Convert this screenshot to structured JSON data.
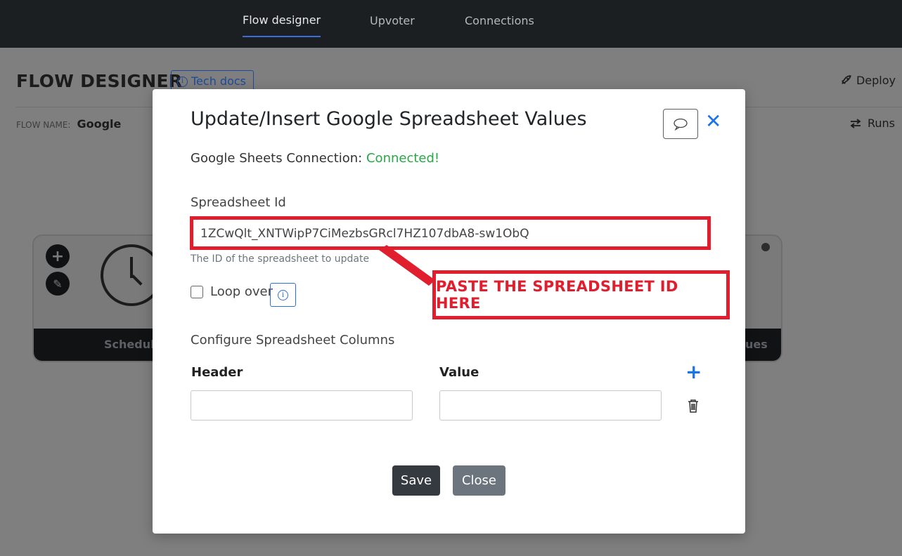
{
  "nav": {
    "tabs": [
      {
        "label": "Flow designer"
      },
      {
        "label": "Upvoter"
      },
      {
        "label": "Connections"
      }
    ]
  },
  "page": {
    "title": "FLOW DESIGNER",
    "tech_docs_label": "Tech docs",
    "deploy_label": "Deploy",
    "flow_name_label": "FLOW NAME:",
    "flow_name_value": "Google",
    "runs_label": "Runs",
    "left_card_label": "Schedule",
    "right_card_label": "ues"
  },
  "modal": {
    "title": "Update/Insert Google Spreadsheet Values",
    "connection_label": "Google Sheets Connection:",
    "connection_status": "Connected!",
    "spreadsheet_id_label": "Spreadsheet Id",
    "spreadsheet_id_value": "1ZCwQlt_XNTWipP7CiMezbsGRcl7HZ107dbA8-sw1ObQ",
    "spreadsheet_id_hint": "The ID of the spreadsheet to update",
    "loop_over_label": "Loop over",
    "loop_over_checked": false,
    "columns_section_label": "Configure Spreadsheet Columns",
    "header_col_label": "Header",
    "value_col_label": "Value",
    "header_input_value": "",
    "value_input_value": "",
    "save_label": "Save",
    "close_label": "Close"
  },
  "annotation": {
    "text": "PASTE THE SPREADSHEET ID HERE",
    "color": "#e11e2d"
  },
  "colors": {
    "connected": "#27a845",
    "accent_blue": "#1a73e8",
    "nav_bg": "#1c1f22"
  },
  "icons": [
    "info-icon",
    "rocket-icon",
    "swap-arrows-icon",
    "plus-icon",
    "pencil-icon",
    "clock-icon",
    "chat-bubble-icon",
    "close-icon",
    "trash-icon"
  ]
}
